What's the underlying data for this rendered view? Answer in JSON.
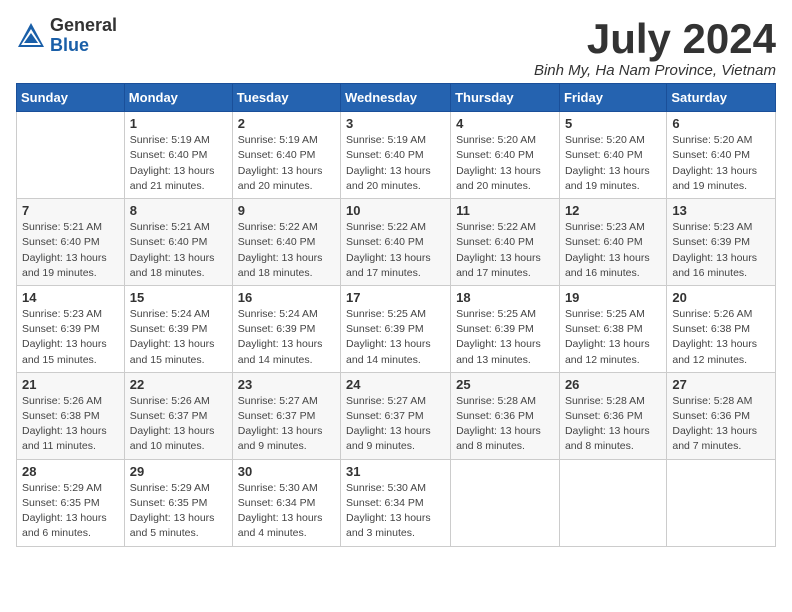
{
  "logo": {
    "general": "General",
    "blue": "Blue"
  },
  "title": "July 2024",
  "location": "Binh My, Ha Nam Province, Vietnam",
  "weekdays": [
    "Sunday",
    "Monday",
    "Tuesday",
    "Wednesday",
    "Thursday",
    "Friday",
    "Saturday"
  ],
  "weeks": [
    [
      {
        "day": "",
        "info": ""
      },
      {
        "day": "1",
        "info": "Sunrise: 5:19 AM\nSunset: 6:40 PM\nDaylight: 13 hours and 21 minutes."
      },
      {
        "day": "2",
        "info": "Sunrise: 5:19 AM\nSunset: 6:40 PM\nDaylight: 13 hours and 20 minutes."
      },
      {
        "day": "3",
        "info": "Sunrise: 5:19 AM\nSunset: 6:40 PM\nDaylight: 13 hours and 20 minutes."
      },
      {
        "day": "4",
        "info": "Sunrise: 5:20 AM\nSunset: 6:40 PM\nDaylight: 13 hours and 20 minutes."
      },
      {
        "day": "5",
        "info": "Sunrise: 5:20 AM\nSunset: 6:40 PM\nDaylight: 13 hours and 19 minutes."
      },
      {
        "day": "6",
        "info": "Sunrise: 5:20 AM\nSunset: 6:40 PM\nDaylight: 13 hours and 19 minutes."
      }
    ],
    [
      {
        "day": "7",
        "info": "Sunrise: 5:21 AM\nSunset: 6:40 PM\nDaylight: 13 hours and 19 minutes."
      },
      {
        "day": "8",
        "info": "Sunrise: 5:21 AM\nSunset: 6:40 PM\nDaylight: 13 hours and 18 minutes."
      },
      {
        "day": "9",
        "info": "Sunrise: 5:22 AM\nSunset: 6:40 PM\nDaylight: 13 hours and 18 minutes."
      },
      {
        "day": "10",
        "info": "Sunrise: 5:22 AM\nSunset: 6:40 PM\nDaylight: 13 hours and 17 minutes."
      },
      {
        "day": "11",
        "info": "Sunrise: 5:22 AM\nSunset: 6:40 PM\nDaylight: 13 hours and 17 minutes."
      },
      {
        "day": "12",
        "info": "Sunrise: 5:23 AM\nSunset: 6:40 PM\nDaylight: 13 hours and 16 minutes."
      },
      {
        "day": "13",
        "info": "Sunrise: 5:23 AM\nSunset: 6:39 PM\nDaylight: 13 hours and 16 minutes."
      }
    ],
    [
      {
        "day": "14",
        "info": "Sunrise: 5:23 AM\nSunset: 6:39 PM\nDaylight: 13 hours and 15 minutes."
      },
      {
        "day": "15",
        "info": "Sunrise: 5:24 AM\nSunset: 6:39 PM\nDaylight: 13 hours and 15 minutes."
      },
      {
        "day": "16",
        "info": "Sunrise: 5:24 AM\nSunset: 6:39 PM\nDaylight: 13 hours and 14 minutes."
      },
      {
        "day": "17",
        "info": "Sunrise: 5:25 AM\nSunset: 6:39 PM\nDaylight: 13 hours and 14 minutes."
      },
      {
        "day": "18",
        "info": "Sunrise: 5:25 AM\nSunset: 6:39 PM\nDaylight: 13 hours and 13 minutes."
      },
      {
        "day": "19",
        "info": "Sunrise: 5:25 AM\nSunset: 6:38 PM\nDaylight: 13 hours and 12 minutes."
      },
      {
        "day": "20",
        "info": "Sunrise: 5:26 AM\nSunset: 6:38 PM\nDaylight: 13 hours and 12 minutes."
      }
    ],
    [
      {
        "day": "21",
        "info": "Sunrise: 5:26 AM\nSunset: 6:38 PM\nDaylight: 13 hours and 11 minutes."
      },
      {
        "day": "22",
        "info": "Sunrise: 5:26 AM\nSunset: 6:37 PM\nDaylight: 13 hours and 10 minutes."
      },
      {
        "day": "23",
        "info": "Sunrise: 5:27 AM\nSunset: 6:37 PM\nDaylight: 13 hours and 9 minutes."
      },
      {
        "day": "24",
        "info": "Sunrise: 5:27 AM\nSunset: 6:37 PM\nDaylight: 13 hours and 9 minutes."
      },
      {
        "day": "25",
        "info": "Sunrise: 5:28 AM\nSunset: 6:36 PM\nDaylight: 13 hours and 8 minutes."
      },
      {
        "day": "26",
        "info": "Sunrise: 5:28 AM\nSunset: 6:36 PM\nDaylight: 13 hours and 8 minutes."
      },
      {
        "day": "27",
        "info": "Sunrise: 5:28 AM\nSunset: 6:36 PM\nDaylight: 13 hours and 7 minutes."
      }
    ],
    [
      {
        "day": "28",
        "info": "Sunrise: 5:29 AM\nSunset: 6:35 PM\nDaylight: 13 hours and 6 minutes."
      },
      {
        "day": "29",
        "info": "Sunrise: 5:29 AM\nSunset: 6:35 PM\nDaylight: 13 hours and 5 minutes."
      },
      {
        "day": "30",
        "info": "Sunrise: 5:30 AM\nSunset: 6:34 PM\nDaylight: 13 hours and 4 minutes."
      },
      {
        "day": "31",
        "info": "Sunrise: 5:30 AM\nSunset: 6:34 PM\nDaylight: 13 hours and 3 minutes."
      },
      {
        "day": "",
        "info": ""
      },
      {
        "day": "",
        "info": ""
      },
      {
        "day": "",
        "info": ""
      }
    ]
  ]
}
